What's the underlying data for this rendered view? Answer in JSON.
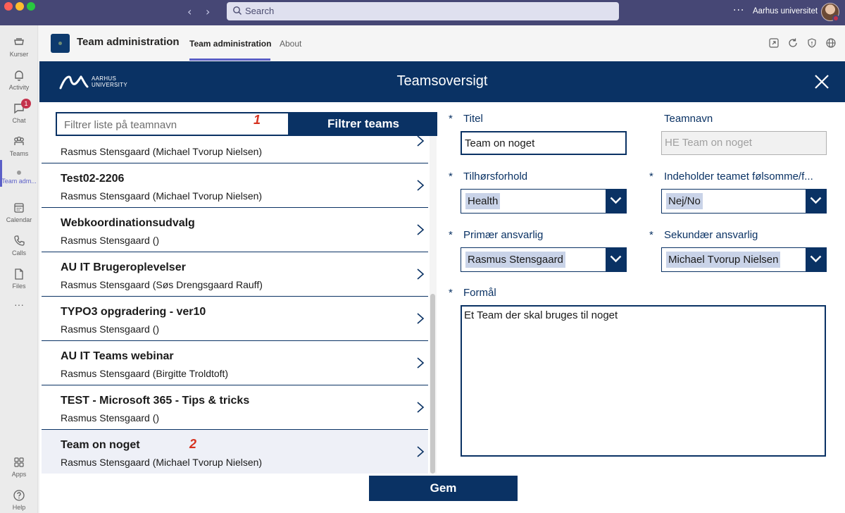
{
  "topbar": {
    "search_placeholder": "Search",
    "org_name": "Aarhus universitet",
    "more_label": "···"
  },
  "rail": {
    "items": [
      {
        "label": "Kurser",
        "icon": "kurser-icon"
      },
      {
        "label": "Activity",
        "icon": "bell-icon"
      },
      {
        "label": "Chat",
        "icon": "chat-icon",
        "badge": "1"
      },
      {
        "label": "Teams",
        "icon": "teams-icon"
      },
      {
        "label": "Team adm...",
        "icon": "app-dot-icon"
      },
      {
        "label": "Calendar",
        "icon": "calendar-icon"
      },
      {
        "label": "Calls",
        "icon": "phone-icon"
      },
      {
        "label": "Files",
        "icon": "file-icon"
      },
      {
        "label": "Apps",
        "icon": "apps-icon"
      },
      {
        "label": "Help",
        "icon": "help-icon"
      }
    ],
    "more_label": "···"
  },
  "apphead": {
    "title": "Team administration",
    "tabs": [
      "Team administration",
      "About"
    ]
  },
  "panel": {
    "title": "Teamsoversigt",
    "logo_text_line1": "AARHUS",
    "logo_text_line2": "UNIVERSITY"
  },
  "filter": {
    "placeholder": "Filtrer liste på teamnavn",
    "button_label": "Filtrer teams",
    "marker": "1"
  },
  "teams": [
    {
      "title": "",
      "sub": "Rasmus Stensgaard (Michael Tvorup Nielsen)"
    },
    {
      "title": "Test02-2206",
      "sub": "Rasmus Stensgaard (Michael Tvorup Nielsen)"
    },
    {
      "title": "Webkoordinationsudvalg",
      "sub": "Rasmus Stensgaard ()"
    },
    {
      "title": "AU IT Brugeroplevelser",
      "sub": "Rasmus Stensgaard (Søs Drengsgaard Rauff)"
    },
    {
      "title": "TYPO3 opgradering - ver10",
      "sub": "Rasmus Stensgaard ()"
    },
    {
      "title": "AU IT Teams webinar",
      "sub": "Rasmus Stensgaard (Birgitte Troldtoft)"
    },
    {
      "title": "TEST - Microsoft 365 - Tips & tricks",
      "sub": "Rasmus Stensgaard ()"
    },
    {
      "title": "Team on noget",
      "sub": "Rasmus Stensgaard (Michael Tvorup Nielsen)"
    }
  ],
  "list_marker": "2",
  "form": {
    "required_mark": "*",
    "titel_label": "Titel",
    "titel_value": "Team on noget",
    "teamnavn_label": "Teamnavn",
    "teamnavn_value": "HE Team on noget",
    "tilhor_label": "Tilhørsforhold",
    "tilhor_value": "Health",
    "sensitive_label": "Indeholder teamet følsomme/f...",
    "sensitive_value": "Nej/No",
    "primary_label": "Primær ansvarlig",
    "primary_value": "Rasmus Stensgaard",
    "secondary_label": "Sekundær ansvarlig",
    "secondary_value": "Michael Tvorup Nielsen",
    "formal_label": "Formål",
    "formal_value": "Et Team der skal bruges til noget",
    "save_label": "Gem"
  },
  "colors": {
    "brand": "#0a3264",
    "teams_purple": "#464775",
    "accent": "#5b5fc7",
    "marker_red": "#d6321f"
  }
}
